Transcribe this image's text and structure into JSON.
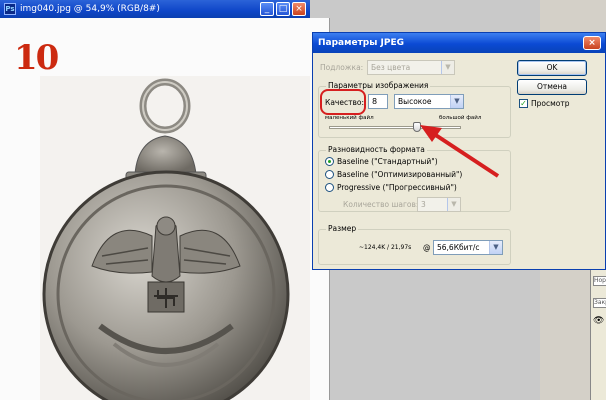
{
  "document": {
    "title": "img040.jpg @ 54,9% (RGB/8#)",
    "step_number": "10"
  },
  "dialog": {
    "title": "Параметры JPEG",
    "matte_label": "Подложка:",
    "matte_value": "Без цвета",
    "image_options_legend": "Параметры изображения",
    "quality_label": "Качество:",
    "quality_value": "8",
    "quality_preset": "Высокое",
    "small_file_label": "маленький файл",
    "large_file_label": "большой файл",
    "format_legend": "Разновидность формата",
    "format_options": [
      {
        "label": "Baseline (\"Стандартный\")",
        "selected": true
      },
      {
        "label": "Baseline (\"Оптимизированный\")",
        "selected": false
      },
      {
        "label": "Progressive (\"Прогрессивный\")",
        "selected": false
      }
    ],
    "scans_label": "Количество шагов:",
    "scans_value": "3",
    "size_legend": "Размер",
    "size_value": "~124,4K / 21,97s",
    "at_symbol": "@",
    "speed_value": "56,6Кбит/с",
    "ok_label": "OK",
    "cancel_label": "Отмена",
    "preview_label": "Просмотр",
    "preview_checked": true,
    "quality_slider_fraction": 0.67
  },
  "right_panel": {
    "rows": [
      "Норм",
      "Закр"
    ]
  },
  "colors": {
    "annotation_red": "#d61f1f",
    "step_number_red": "#cc2a10",
    "xp_title_blue": "#0b4ad4"
  },
  "icons": [
    "photoshop-icon",
    "minimize-icon",
    "maximize-icon",
    "close-icon",
    "chevron-down-icon",
    "eye-icon"
  ]
}
